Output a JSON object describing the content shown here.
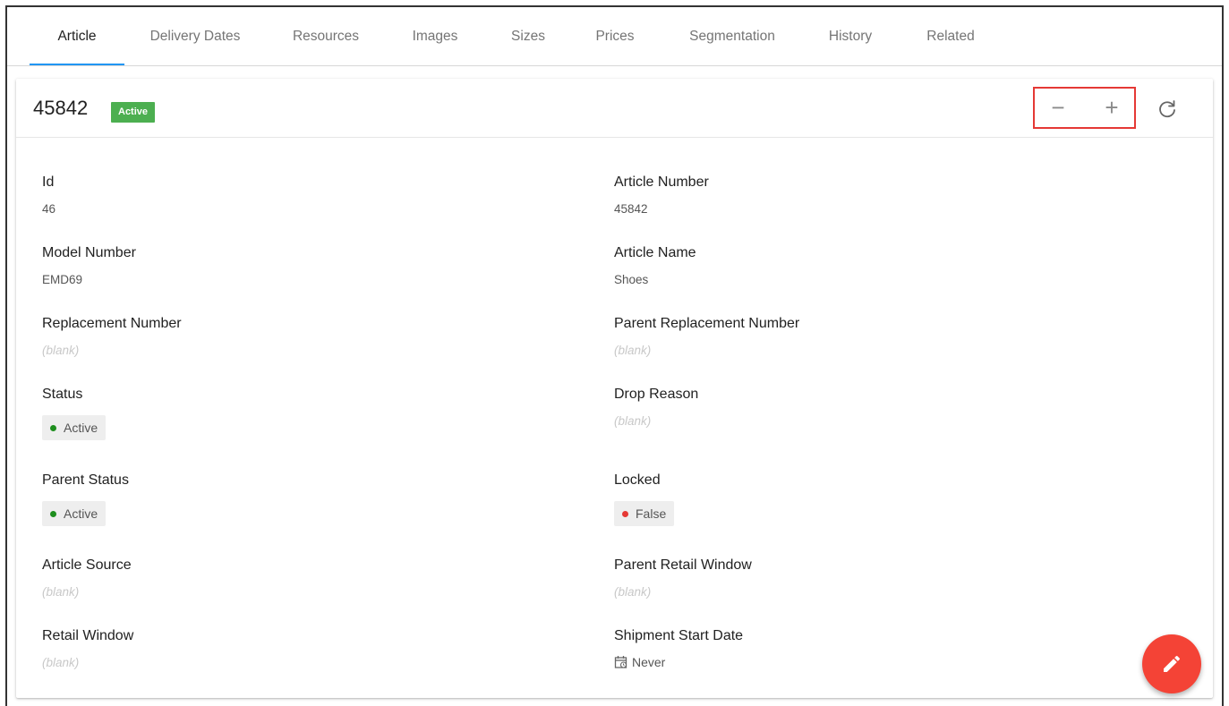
{
  "tabs": [
    {
      "label": "Article",
      "active": true
    },
    {
      "label": "Delivery Dates",
      "active": false
    },
    {
      "label": "Resources",
      "active": false
    },
    {
      "label": "Images",
      "active": false
    },
    {
      "label": "Sizes",
      "active": false
    },
    {
      "label": "Prices",
      "active": false
    },
    {
      "label": "Segmentation",
      "active": false
    },
    {
      "label": "History",
      "active": false
    },
    {
      "label": "Related",
      "active": false
    }
  ],
  "header": {
    "title": "45842",
    "status_badge": "Active",
    "zoom_out_label": "−",
    "zoom_in_label": "+"
  },
  "fields": {
    "id": {
      "label": "Id",
      "value": "46"
    },
    "article_number": {
      "label": "Article Number",
      "value": "45842"
    },
    "model_number": {
      "label": "Model Number",
      "value": "EMD69"
    },
    "article_name": {
      "label": "Article Name",
      "value": "Shoes"
    },
    "replacement_number": {
      "label": "Replacement Number",
      "value": "(blank)"
    },
    "parent_replacement_number": {
      "label": "Parent Replacement Number",
      "value": "(blank)"
    },
    "status": {
      "label": "Status",
      "value": "Active"
    },
    "drop_reason": {
      "label": "Drop Reason",
      "value": "(blank)"
    },
    "parent_status": {
      "label": "Parent Status",
      "value": "Active"
    },
    "locked": {
      "label": "Locked",
      "value": "False"
    },
    "article_source": {
      "label": "Article Source",
      "value": "(blank)"
    },
    "parent_retail_window": {
      "label": "Parent Retail Window",
      "value": "(blank)"
    },
    "retail_window": {
      "label": "Retail Window",
      "value": "(blank)"
    },
    "shipment_start_date": {
      "label": "Shipment Start Date",
      "value": "Never"
    }
  },
  "icons": {
    "refresh": "refresh-icon",
    "edit": "pencil-icon",
    "calendar": "calendar-icon"
  },
  "colors": {
    "accent": "#2196f3",
    "active_green": "#4caf50",
    "dot_green": "#1e8e1e",
    "dot_red": "#e53935",
    "fab_red": "#f44336",
    "highlight_box": "#e53935"
  }
}
